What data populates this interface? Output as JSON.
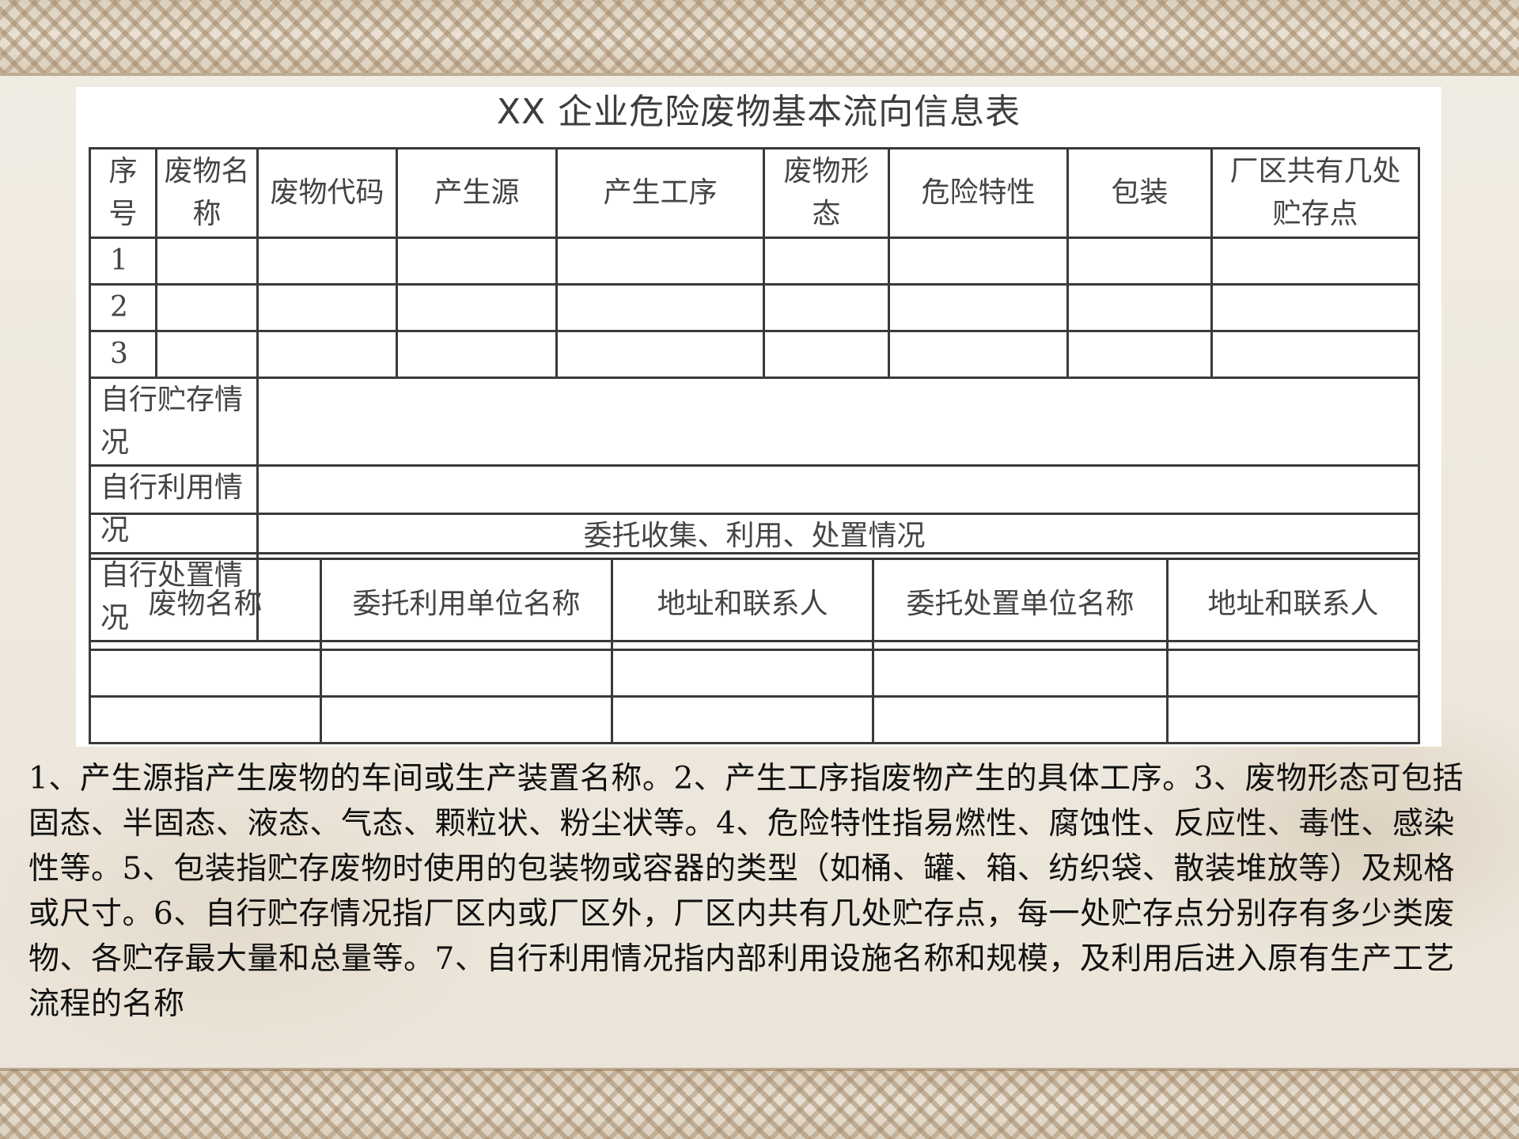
{
  "form": {
    "title": "XX 企业危险废物基本流向信息表",
    "header": {
      "seq": "序号",
      "waste_name": "废物名称",
      "waste_code": "废物代码",
      "source": "产生源",
      "process": "产生工序",
      "form_state": "废物形态",
      "hazard": "危险特性",
      "packaging": "包装",
      "storage_points": "厂区共有几处贮存点"
    },
    "rows": [
      "1",
      "2",
      "3"
    ],
    "self_storage": "自行贮存情况",
    "self_use": "自行利用情况",
    "self_disposal": "自行处置情况",
    "entrust_title": "委托收集、利用、处置情况",
    "entrust_header": {
      "waste_name": "废物名称",
      "use_unit": "委托利用单位名称",
      "contact1": "地址和联系人",
      "disposal_unit": "委托处置单位名称",
      "contact2": "地址和联系人"
    }
  },
  "notes": "1、产生源指产生废物的车间或生产装置名称。2、产生工序指废物产生的具体工序。3、废物形态可包括固态、半固态、液态、气态、颗粒状、粉尘状等。4、危险特性指易燃性、腐蚀性、反应性、毒性、感染性等。5、包装指贮存废物时使用的包装物或容器的类型（如桶、罐、箱、纺织袋、散装堆放等）及规格或尺寸。6、自行贮存情况指厂区内或厂区外，厂区内共有几处贮存点，每一处贮存点分别存有多少类废物、各贮存最大量和总量等。7、自行利用情况指内部利用设施名称和规模，及利用后进入原有生产工艺流程的名称"
}
